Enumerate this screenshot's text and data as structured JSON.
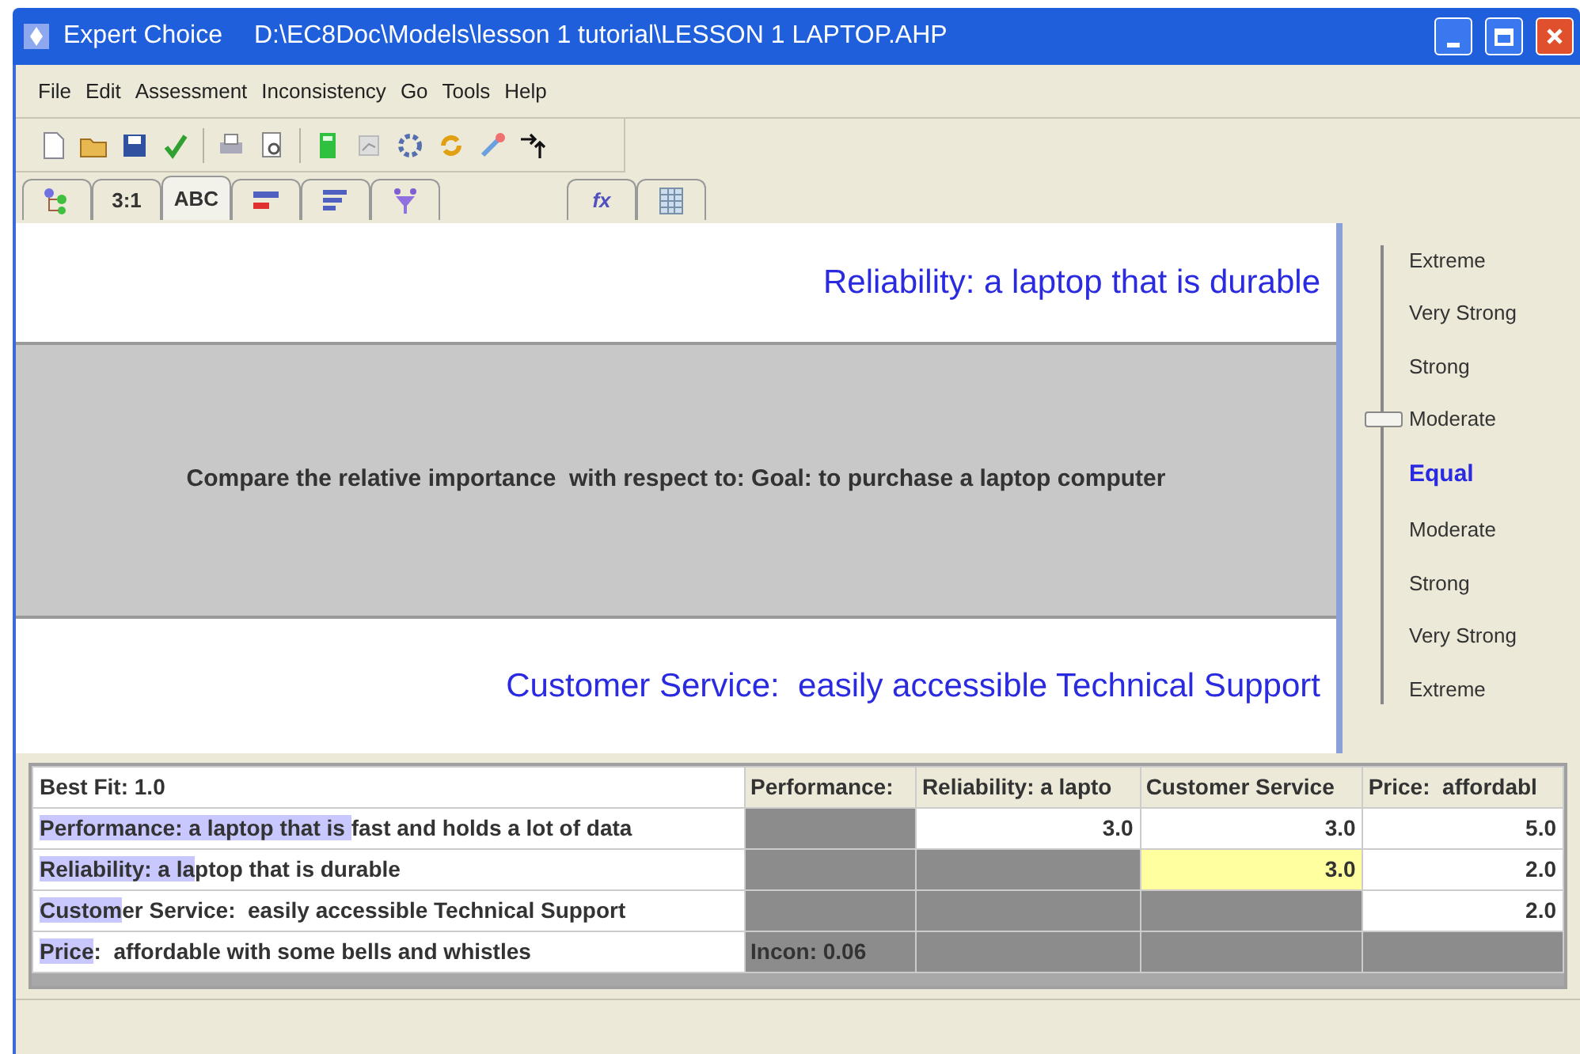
{
  "window": {
    "app": "Expert Choice",
    "path": "D:\\EC8Doc\\Models\\lesson 1 tutorial\\LESSON 1 LAPTOP.AHP"
  },
  "menu": [
    {
      "label": "File"
    },
    {
      "label": "Edit"
    },
    {
      "label": "Assessment"
    },
    {
      "label": "Inconsistency"
    },
    {
      "label": "Go"
    },
    {
      "label": "Tools"
    },
    {
      "label": "Help"
    }
  ],
  "toolbar": [
    {
      "kind": "new"
    },
    {
      "kind": "open"
    },
    {
      "kind": "save"
    },
    {
      "kind": "check"
    },
    {
      "kind": "sep"
    },
    {
      "kind": "print"
    },
    {
      "kind": "preview"
    },
    {
      "kind": "sep"
    },
    {
      "kind": "calc"
    },
    {
      "kind": "chart"
    },
    {
      "kind": "gear"
    },
    {
      "kind": "refresh"
    },
    {
      "kind": "wand"
    },
    {
      "kind": "arrows"
    }
  ],
  "tabs": [
    {
      "kind": "tree",
      "selected": false
    },
    {
      "kind": "text",
      "label": "3:1",
      "selected": false
    },
    {
      "kind": "text",
      "label": "ABC",
      "selected": true
    },
    {
      "kind": "bars",
      "selected": false
    },
    {
      "kind": "lines",
      "selected": false
    },
    {
      "kind": "funnel",
      "selected": false
    },
    {
      "kind": "gap"
    },
    {
      "kind": "text",
      "label": "fx",
      "selected": false
    },
    {
      "kind": "grid",
      "selected": false
    }
  ],
  "comparison": {
    "top": "Reliability: a laptop that is durable",
    "question": "Compare the relative importance  with respect to: Goal: to purchase a laptop computer",
    "bottom": "Customer Service:  easily accessible Technical Support"
  },
  "scale": {
    "level": 0.625,
    "labels": [
      {
        "label": "Extreme",
        "kind": "intensity"
      },
      {
        "label": "Very Strong",
        "kind": "intensity"
      },
      {
        "label": "Strong",
        "kind": "intensity"
      },
      {
        "label": "Moderate",
        "kind": "intensity"
      },
      {
        "label": "Equal",
        "kind": "equal"
      },
      {
        "label": "Moderate",
        "kind": "intensity"
      },
      {
        "label": "Strong",
        "kind": "intensity"
      },
      {
        "label": "Very Strong",
        "kind": "intensity"
      },
      {
        "label": "Extreme",
        "kind": "intensity"
      }
    ]
  },
  "matrix": {
    "corner": "Best Fit: 1.0",
    "columns": [
      "Performance:",
      "Reliability: a lapto",
      "Customer Service",
      "Price:  affordabl"
    ],
    "rows": [
      {
        "highlight": "Performance: a laptop that is ",
        "rest": "fast and holds a lot of data",
        "cells": [
          {
            "kind": "blank"
          },
          {
            "kind": "value",
            "value": "3.0",
            "selected": false
          },
          {
            "kind": "value",
            "value": "3.0",
            "selected": false
          },
          {
            "kind": "value",
            "value": "5.0",
            "selected": false
          }
        ]
      },
      {
        "highlight": "Reliability: a la",
        "rest": "ptop that is durable",
        "cells": [
          {
            "kind": "blank"
          },
          {
            "kind": "blank"
          },
          {
            "kind": "value",
            "value": "3.0",
            "selected": true
          },
          {
            "kind": "value",
            "value": "2.0",
            "selected": false
          }
        ]
      },
      {
        "highlight": "Custom",
        "rest": "er Service:  easily accessible Technical Support",
        "cells": [
          {
            "kind": "blank"
          },
          {
            "kind": "blank"
          },
          {
            "kind": "blank"
          },
          {
            "kind": "value",
            "value": "2.0",
            "selected": false
          }
        ]
      },
      {
        "highlight": "Price",
        "rest": ":  affordable with some bells and whistles",
        "cells": [
          {
            "kind": "note",
            "value": "Incon: 0.06"
          },
          {
            "kind": "blank"
          },
          {
            "kind": "blank"
          },
          {
            "kind": "blank"
          }
        ]
      }
    ]
  }
}
